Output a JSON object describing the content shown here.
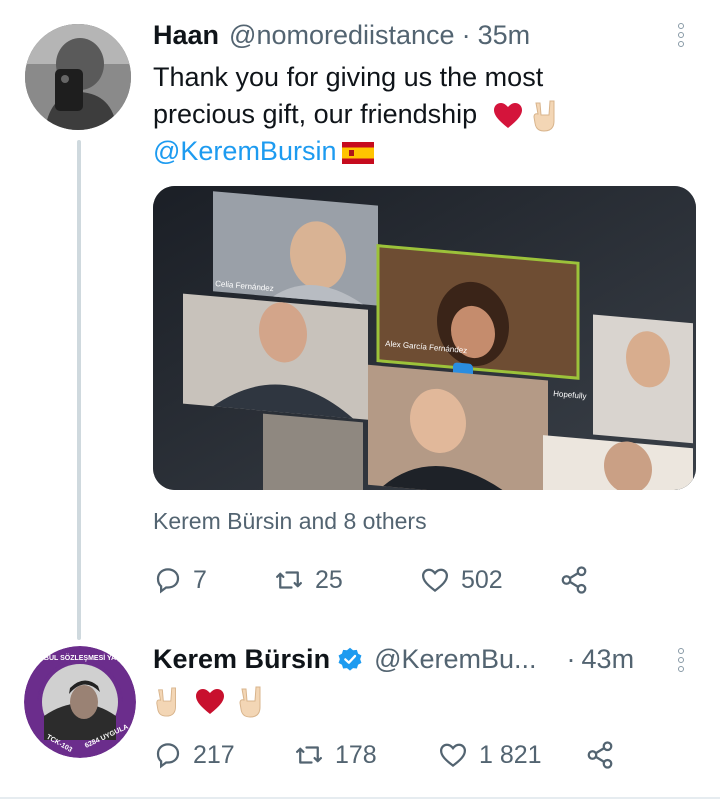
{
  "tweet1": {
    "name": "Haan",
    "handle": "@nomorediistance",
    "separator": "·",
    "time": "35m",
    "line1": "Thank you for giving us the most",
    "line2": "precious gift, our friendship",
    "mention": "@KeremBursin",
    "image_caption_labels": [
      "Celia Fernández",
      "Alex García Fernández",
      "Hopefully"
    ],
    "liked_by": "Kerem Bürsin and 8 others",
    "replies": "7",
    "retweets": "25",
    "likes": "502",
    "icons": [
      "more-vert-icon",
      "heart-emoji",
      "rock-hand-emoji",
      "spain-flag-icon",
      "reply-icon",
      "retweet-icon",
      "like-icon",
      "share-icon"
    ]
  },
  "tweet2": {
    "name": "Kerem Bürsin",
    "handle": "@KeremBu...",
    "separator": "·",
    "time": "43m",
    "avatar_ring_text_top": "İSTANBUL SÖZLEŞMESİ YAŞATIR",
    "avatar_ring_text_bottom": "6284 UYGULA",
    "avatar_ring_text_left": "TCK-103",
    "replies": "217",
    "retweets": "178",
    "likes": "1 821"
  },
  "colors": {
    "accent": "#1d9bf0",
    "secondary_text": "#536471",
    "heart": "#d4143b",
    "avatar_ring": "#6b2d8c"
  }
}
